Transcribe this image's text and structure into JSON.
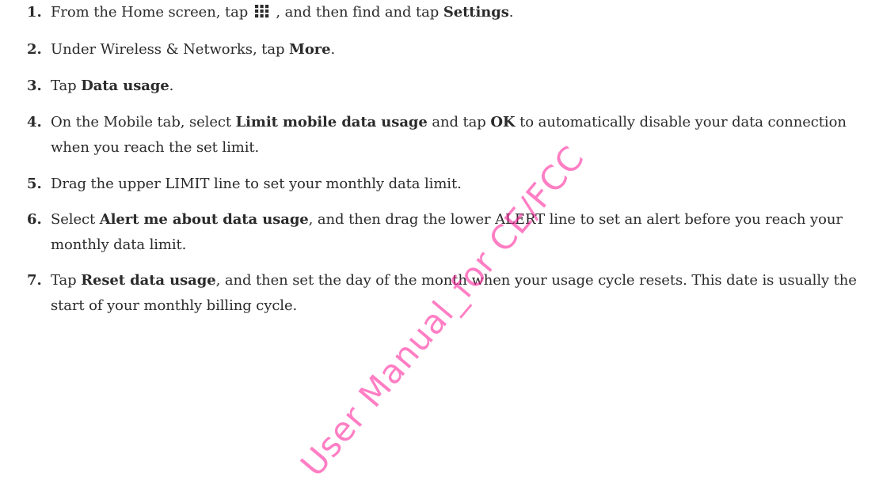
{
  "steps": [
    {
      "num": "1.",
      "parts": [
        {
          "t": "From the Home screen, tap "
        },
        {
          "icon": "apps-grid-icon"
        },
        {
          "t": " , and then find and tap "
        },
        {
          "t": "Settings",
          "bold": true
        },
        {
          "t": "."
        }
      ]
    },
    {
      "num": "2.",
      "parts": [
        {
          "t": "Under Wireless & Networks, tap "
        },
        {
          "t": "More",
          "bold": true
        },
        {
          "t": "."
        }
      ]
    },
    {
      "num": "3.",
      "parts": [
        {
          "t": "Tap "
        },
        {
          "t": "Data usage",
          "bold": true
        },
        {
          "t": "."
        }
      ]
    },
    {
      "num": "4.",
      "parts": [
        {
          "t": "On the Mobile tab, select "
        },
        {
          "t": "Limit mobile data usage",
          "bold": true
        },
        {
          "t": " and tap "
        },
        {
          "t": "OK",
          "bold": true
        },
        {
          "t": " to automatically disable your data connection when you reach the set limit."
        }
      ]
    },
    {
      "num": "5.",
      "parts": [
        {
          "t": "Drag the upper LIMIT line to set your monthly data limit."
        }
      ]
    },
    {
      "num": "6.",
      "parts": [
        {
          "t": "Select "
        },
        {
          "t": "Alert me about data usage",
          "bold": true
        },
        {
          "t": ", and then drag the lower ALERT line to set an alert before you reach your monthly data limit."
        }
      ]
    },
    {
      "num": "7.",
      "parts": [
        {
          "t": "Tap "
        },
        {
          "t": "Reset data usage",
          "bold": true
        },
        {
          "t": ", and then set the day of the month when your usage cycle resets. This date is usually the start of your monthly billing cycle."
        }
      ]
    }
  ],
  "watermark": {
    "text": "User Manual_for CE/FCC",
    "color": "#ff1493"
  }
}
